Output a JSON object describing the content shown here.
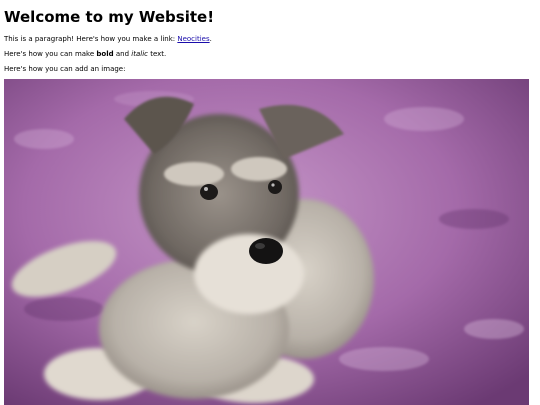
{
  "heading": "Welcome to my Website!",
  "paragraph1": {
    "before": "This is a paragraph! Here's how you make a link: ",
    "link_text": "Neocities",
    "after": "."
  },
  "paragraph2": {
    "before": "Here's how you can make ",
    "bold": "bold",
    "middle": " and ",
    "italic": "italic",
    "after": " text."
  },
  "paragraph3": "Here's how you can add an image:",
  "image": {
    "subject": "schnauzer puppy lying on a purple shaggy carpet",
    "colors": {
      "carpet": "#a46aa9",
      "carpet_dark": "#6b3a73",
      "fur": "#b8b1a8",
      "fur_dark": "#4f4944"
    }
  },
  "colors": {
    "link": "#1a0dab",
    "text": "#000000",
    "background": "#ffffff"
  }
}
